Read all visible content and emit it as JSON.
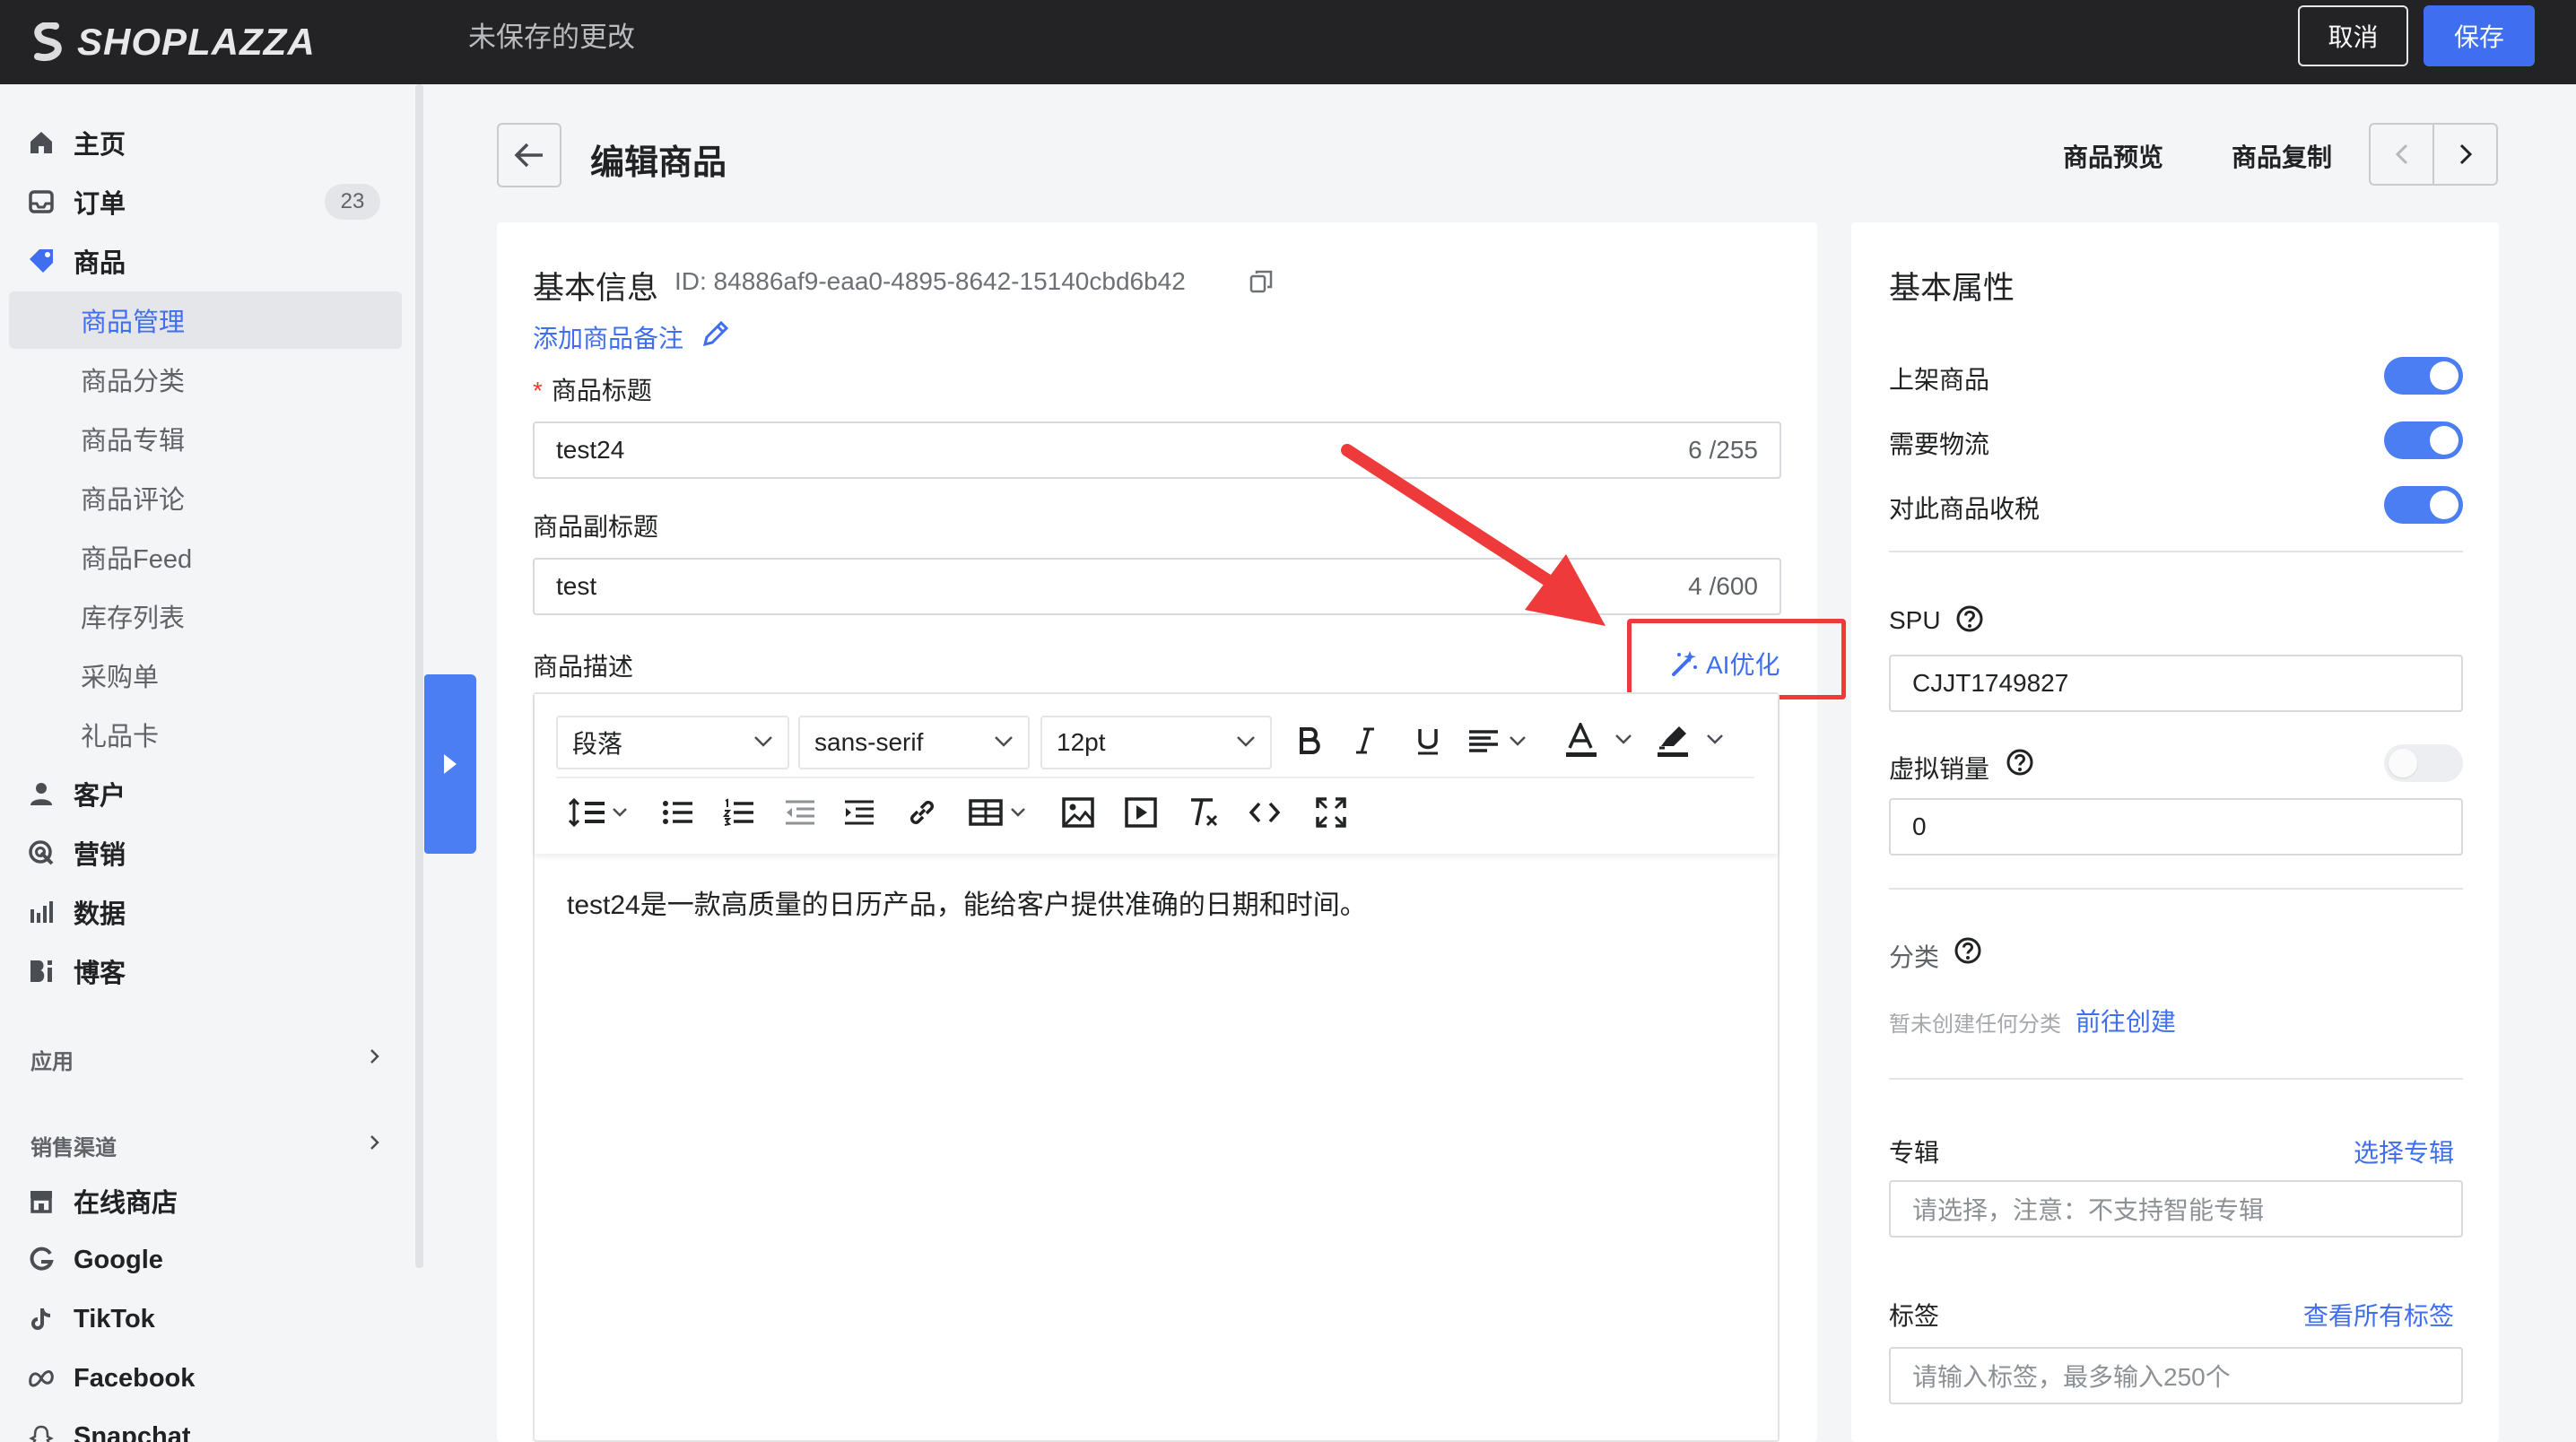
{
  "app": {
    "logo_text": "SHOPLAZZA",
    "unsaved_text": "未保存的更改",
    "cancel_label": "取消",
    "save_label": "保存",
    "accent_color": "#3f6ef0"
  },
  "sidebar": {
    "items": [
      {
        "label": "主页",
        "icon": "home-icon"
      },
      {
        "label": "订单",
        "icon": "inbox-icon",
        "badge": "23"
      },
      {
        "label": "商品",
        "icon": "tag-icon"
      },
      {
        "label": "客户",
        "icon": "user-icon"
      },
      {
        "label": "营销",
        "icon": "target-icon"
      },
      {
        "label": "数据",
        "icon": "bar-chart-icon"
      },
      {
        "label": "博客",
        "icon": "blog-icon"
      }
    ],
    "product_sub": [
      "商品管理",
      "商品分类",
      "商品专辑",
      "商品评论",
      "商品Feed",
      "库存列表",
      "采购单",
      "礼品卡"
    ],
    "apps_heading": "应用",
    "channels_heading": "销售渠道",
    "channels": [
      {
        "label": "在线商店",
        "icon": "store-icon"
      },
      {
        "label": "Google",
        "icon": "google-icon"
      },
      {
        "label": "TikTok",
        "icon": "tiktok-icon"
      },
      {
        "label": "Facebook",
        "icon": "meta-icon"
      },
      {
        "label": "Snapchat",
        "icon": "snapchat-icon"
      }
    ]
  },
  "header": {
    "title": "编辑商品",
    "preview_label": "商品预览",
    "copy_label": "商品复制"
  },
  "basic": {
    "title": "基本信息",
    "id_text": "ID: 84886af9-eaa0-4895-8642-15140cbd6b42",
    "add_note_label": "添加商品备注",
    "title_label": "商品标题",
    "title_required": "*",
    "title_value": "test24",
    "title_count": "6 /255",
    "subtitle_label": "商品副标题",
    "subtitle_value": "test",
    "subtitle_count": "4 /600",
    "desc_label": "商品描述",
    "ai_label": "AI优化"
  },
  "editor": {
    "paragraph_select": "段落",
    "font_select": "sans-serif",
    "size_select": "12pt",
    "content": "test24是一款高质量的日历产品，能给客户提供准确的日期和时间。"
  },
  "attributes": {
    "title": "基本属性",
    "toggles": [
      {
        "label": "上架商品",
        "on": true
      },
      {
        "label": "需要物流",
        "on": true
      },
      {
        "label": "对此商品收税",
        "on": true
      }
    ],
    "spu_label": "SPU",
    "spu_value": "CJJT1749827",
    "virtual_sales_label": "虚拟销量",
    "virtual_sales_on": false,
    "virtual_sales_value": "0",
    "category_label": "分类",
    "category_empty": "暂未创建任何分类",
    "category_create": "前往创建",
    "collection_label": "专辑",
    "collection_link": "选择专辑",
    "collection_placeholder": "请选择，注意：不支持智能专辑",
    "tags_label": "标签",
    "tags_link": "查看所有标签",
    "tags_placeholder": "请输入标签，最多输入250个"
  }
}
